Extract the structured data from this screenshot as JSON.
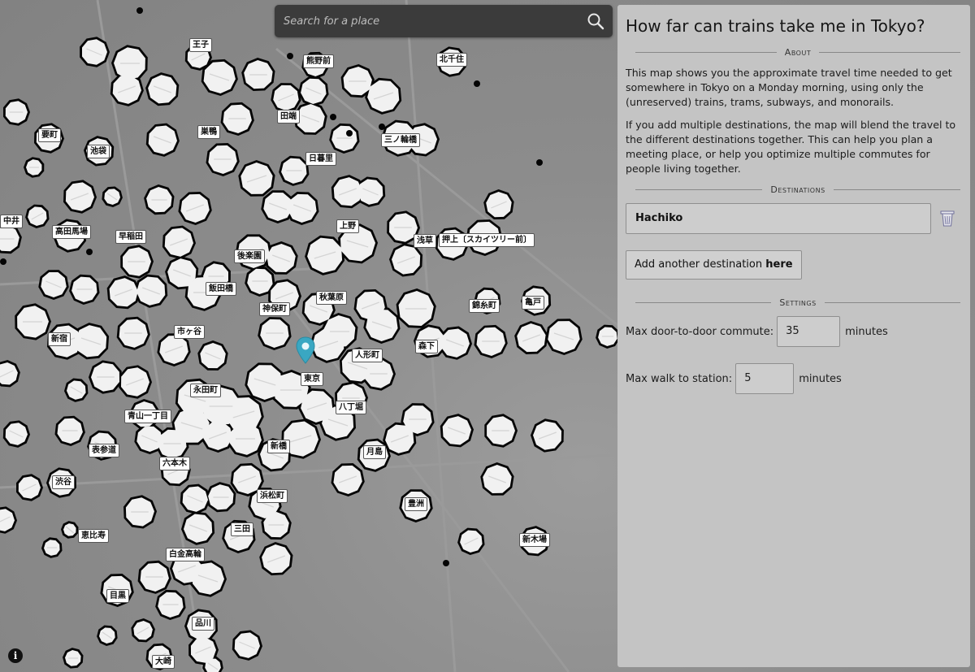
{
  "search": {
    "placeholder": "Search for a place"
  },
  "map": {
    "stations": [
      {
        "name": "王子"
      },
      {
        "name": "熊野前"
      },
      {
        "name": "北千住"
      },
      {
        "name": "田端"
      },
      {
        "name": "要町"
      },
      {
        "name": "巣鴨"
      },
      {
        "name": "三ノ輪橋"
      },
      {
        "name": "池袋"
      },
      {
        "name": "日暮里"
      },
      {
        "name": "中井"
      },
      {
        "name": "高田馬場"
      },
      {
        "name": "早稲田"
      },
      {
        "name": "上野"
      },
      {
        "name": "浅草"
      },
      {
        "name": "押上〔スカイツリー前〕"
      },
      {
        "name": "後楽園"
      },
      {
        "name": "飯田橋"
      },
      {
        "name": "秋葉原"
      },
      {
        "name": "錦糸町"
      },
      {
        "name": "亀戸"
      },
      {
        "name": "神保町"
      },
      {
        "name": "市ヶ谷"
      },
      {
        "name": "新宿"
      },
      {
        "name": "森下"
      },
      {
        "name": "人形町"
      },
      {
        "name": "東京"
      },
      {
        "name": "永田町"
      },
      {
        "name": "八丁堀"
      },
      {
        "name": "青山一丁目"
      },
      {
        "name": "表参道"
      },
      {
        "name": "新橋"
      },
      {
        "name": "月島"
      },
      {
        "name": "六本木"
      },
      {
        "name": "渋谷"
      },
      {
        "name": "浜松町"
      },
      {
        "name": "豊洲"
      },
      {
        "name": "恵比寿"
      },
      {
        "name": "三田"
      },
      {
        "name": "新木場"
      },
      {
        "name": "白金高輪"
      },
      {
        "name": "目黒"
      },
      {
        "name": "品川"
      },
      {
        "name": "大崎"
      }
    ]
  },
  "panel": {
    "title": "How far can trains take me in Tokyo?",
    "about_heading": "About",
    "about_p1": "This map shows you the approximate travel time needed to get somewhere in Tokyo on a Monday morning, using only the (unreserved) trains, trams, subways, and monorails.",
    "about_p2": "If you add multiple destinations, the map will blend the travel to the different destinations together. This can help you plan a meeting place, or help you optimize multiple commutes for people living together.",
    "destinations_heading": "Destinations",
    "destination_value": "Hachiko",
    "add_prefix": "Add another destination ",
    "add_bold": "here",
    "settings_heading": "Settings",
    "commute_label": "Max door-to-door commute:",
    "commute_value": "35",
    "commute_unit": "minutes",
    "walk_label": "Max walk to station:",
    "walk_value": "5",
    "walk_unit": "minutes"
  }
}
